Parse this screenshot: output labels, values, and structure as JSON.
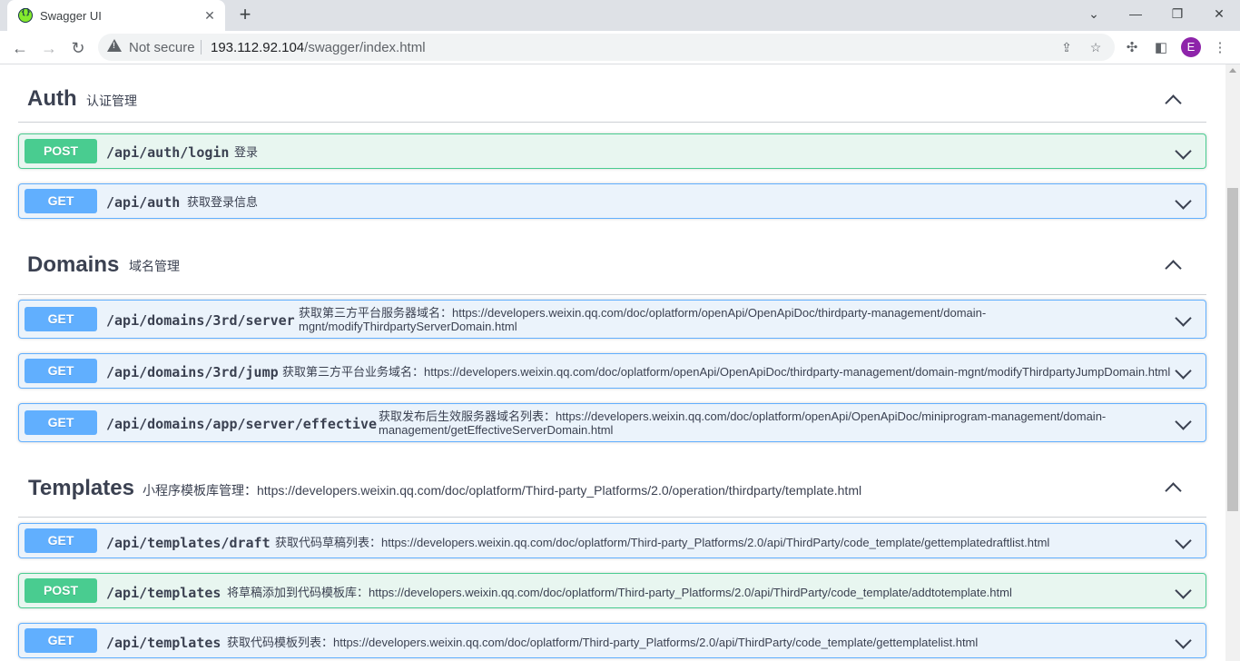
{
  "browser": {
    "tab_title": "Swagger UI",
    "tab_close": "✕",
    "new_tab": "+",
    "not_secure": "Not secure",
    "url_host": "193.112.92.104",
    "url_path": "/swagger/index.html",
    "avatar_letter": "E",
    "icons": [
      "swagger-favicon",
      "back-icon",
      "forward-icon",
      "reload-icon",
      "warning-icon",
      "share-icon",
      "star-icon",
      "extensions-icon",
      "side-panel-icon",
      "menu-icon",
      "minimize-icon",
      "maximize-icon",
      "close-icon"
    ]
  },
  "sections": [
    {
      "name": "Auth",
      "desc": "认证管理",
      "ops": [
        {
          "method": "POST",
          "path": "/api/auth/login",
          "summary": "登录"
        },
        {
          "method": "GET",
          "path": "/api/auth",
          "summary": "获取登录信息"
        }
      ]
    },
    {
      "name": "Domains",
      "desc": "域名管理",
      "ops": [
        {
          "method": "GET",
          "path": "/api/domains/3rd/server",
          "summary_line1": "获取第三方平台服务器域名：https://developers.weixin.qq.com/doc/oplatform/openApi/OpenApiDoc/thirdparty-management/domain-",
          "summary_line2": "mgnt/modifyThirdpartyServerDomain.html"
        },
        {
          "method": "GET",
          "path": "/api/domains/3rd/jump",
          "summary": "获取第三方平台业务域名：https://developers.weixin.qq.com/doc/oplatform/openApi/OpenApiDoc/thirdparty-management/domain-mgnt/modifyThirdpartyJumpDomain.html"
        },
        {
          "method": "GET",
          "path": "/api/domains/app/server/effective",
          "summary_line1": "获取发布后生效服务器域名列表：https://developers.weixin.qq.com/doc/oplatform/openApi/OpenApiDoc/miniprogram-management/domain-",
          "summary_line2": "management/getEffectiveServerDomain.html"
        }
      ]
    },
    {
      "name": "Templates",
      "desc": "小程序模板库管理：https://developers.weixin.qq.com/doc/oplatform/Third-party_Platforms/2.0/operation/thirdparty/template.html",
      "ops": [
        {
          "method": "GET",
          "path": "/api/templates/draft",
          "summary": "获取代码草稿列表：https://developers.weixin.qq.com/doc/oplatform/Third-party_Platforms/2.0/api/ThirdParty/code_template/gettemplatedraftlist.html"
        },
        {
          "method": "POST",
          "path": "/api/templates",
          "summary": "将草稿添加到代码模板库：https://developers.weixin.qq.com/doc/oplatform/Third-party_Platforms/2.0/api/ThirdParty/code_template/addtotemplate.html"
        },
        {
          "method": "GET",
          "path": "/api/templates",
          "summary": "获取代码模板列表：https://developers.weixin.qq.com/doc/oplatform/Third-party_Platforms/2.0/api/ThirdParty/code_template/gettemplatelist.html"
        }
      ]
    }
  ],
  "colors": {
    "post": "#49cc90",
    "get": "#61affe",
    "text": "#3b4151"
  }
}
